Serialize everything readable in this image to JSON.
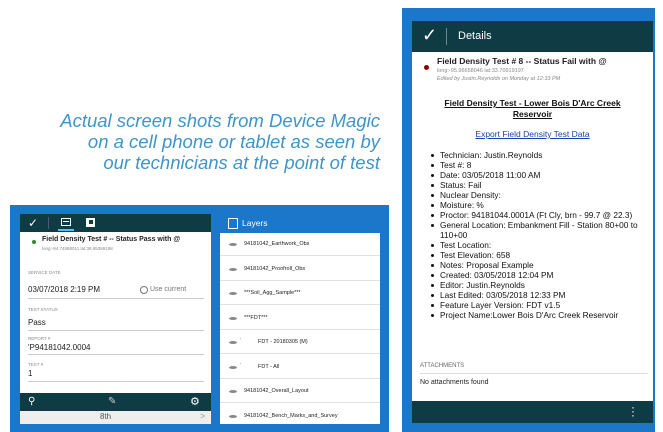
{
  "caption": {
    "line1": "Actual screen shots from Device Magic",
    "line2": "on a cell phone or tablet as seen by",
    "line3": "our technicians at the point of test"
  },
  "form_screen": {
    "title": "Field Density Test #  -- Status Pass with @",
    "coords": "long:-94.74588011 lat:38.95399198",
    "service_date_label": "SERVICE DATE",
    "service_date_value": "03/07/2018 2:19 PM",
    "use_current": "Use current",
    "test_status_label": "TEST STATUS",
    "test_status_value": "Pass",
    "report_label": "REPORT #",
    "report_value": "'P94181042.0004",
    "test_label": "TEST #",
    "test_value": "1",
    "pager_label": "8th",
    "pager_arrow": ">"
  },
  "layers_screen": {
    "title": "Layers",
    "items": [
      {
        "name": "94181042_Earthwork_Obs",
        "indent": false
      },
      {
        "name": "94181042_Proofroll_Obs",
        "indent": false
      },
      {
        "name": "***Soil_Agg_Sample***",
        "indent": false
      },
      {
        "name": "***FDT***",
        "indent": false
      },
      {
        "name": "FDT - 20180305 (M)",
        "indent": true
      },
      {
        "name": "FDT - All",
        "indent": true
      },
      {
        "name": "94181042_Overall_Layout",
        "indent": false
      },
      {
        "name": "94181042_Bench_Marks_and_Survey",
        "indent": false
      }
    ]
  },
  "details_screen": {
    "header": "Details",
    "title": "Field Density Test # 8 -- Status Fail with @",
    "coords": "long:-95.96658046 lat:33.70919197",
    "edited": "Edited by Justin.Reynolds on Monday at 12:33 PM",
    "heading_line1": "Field Density Test - Lower Bois D'Arc Creek",
    "heading_line2": "Reservoir",
    "export_link": "Export Field Density Test Data",
    "fields": [
      "Technician: Justin.Reynolds",
      "Test #: 8",
      "Date: 03/05/2018 11:00 AM",
      "Status: Fail",
      "Nuclear Density:",
      "Moisture: %",
      "Proctor: 94181044.0001A (Ft Cly, brn - 99.7 @ 22.3)",
      "General Location: Embankment Fill - Station 80+00 to 110+00",
      "Test Location:",
      "Test Elevation: 658",
      "Notes: Proposal Example",
      "Created: 03/05/2018 12:04 PM",
      "Editor: Justin.Reynolds",
      "Last Edited: 03/05/2018 12:33 PM",
      "Feature Layer Version: FDT v1.5",
      "Project Name:Lower Bois D'Arc Creek Reservoir"
    ],
    "attachments_label": "ATTACHMENTS",
    "attachments_text": "No attachments found"
  },
  "colors": {
    "accent_blue": "#1a77c9",
    "dark_teal": "#0f3b45",
    "caption_blue": "#3f95c8",
    "link_blue": "#1a3fb0"
  }
}
